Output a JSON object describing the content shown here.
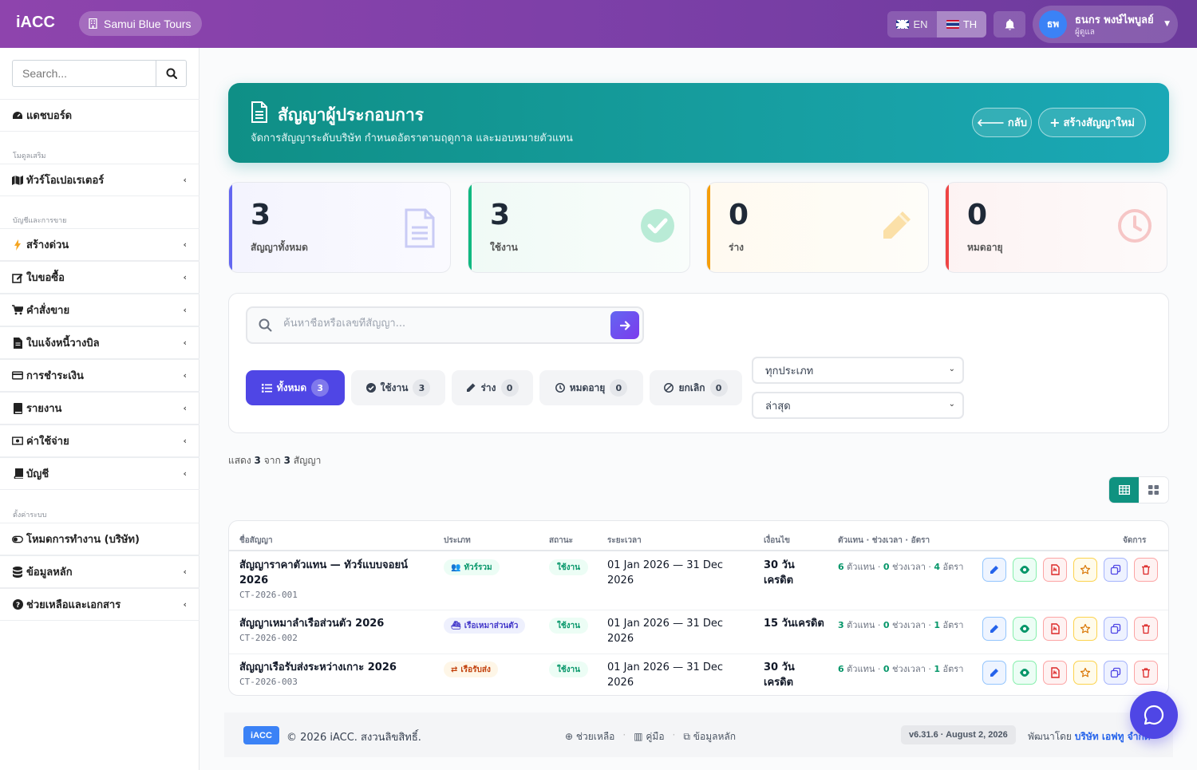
{
  "topbar": {
    "brand": "iACC",
    "company": "Samui Blue Tours",
    "langs": [
      {
        "code": "EN",
        "active": false
      },
      {
        "code": "TH",
        "active": true
      }
    ],
    "user_name": "ธนกร พงษ์ไพบูลย์",
    "user_role": "ผู้ดูแล",
    "user_initials": "ธพ",
    "accent": "#8e44ad"
  },
  "sidebar": {
    "search_placeholder": "Search...",
    "dashboard": "แดชบอร์ด",
    "section_addons": "โมดูลเสริม",
    "tour_operator": "ทัวร์โอเปอเรเตอร์",
    "section_accounting": "บัญชีและการขาย",
    "items": [
      "สร้างด่วน",
      "ใบขอซื้อ",
      "คำสั่งขาย",
      "ใบแจ้งหนี้วางบิล",
      "การชำระเงิน",
      "รายงาน",
      "ค่าใช้จ่าย",
      "บัญชี"
    ],
    "section_settings": "ตั้งค่าระบบ",
    "settings_items": [
      "โหมดการทำงาน (บริษัท)",
      "ข้อมูลหลัก",
      "ช่วยเหลือและเอกสาร"
    ]
  },
  "hero": {
    "title": "สัญญาผู้ประกอบการ",
    "subtitle": "จัดการสัญญาระดับบริษัท กำหนดอัตราตามฤดูกาล และมอบหมายตัวแทน",
    "back_label": "กลับ",
    "new_label": "สร้างสัญญาใหม่",
    "color": "#0f8f86"
  },
  "stats": [
    {
      "value": "3",
      "label": "สัญญาทั้งหมด",
      "color": "#6366f1",
      "icon": "document-icon"
    },
    {
      "value": "3",
      "label": "ใช้งาน",
      "color": "#10b981",
      "icon": "check-circle-icon"
    },
    {
      "value": "0",
      "label": "ร่าง",
      "color": "#f59e0b",
      "icon": "pencil-icon"
    },
    {
      "value": "0",
      "label": "หมดอายุ",
      "color": "#ef4444",
      "icon": "clock-icon"
    }
  ],
  "filters": {
    "search_placeholder": "ค้นหาชื่อหรือเลขที่สัญญา...",
    "tabs": [
      {
        "label": "ทั้งหมด",
        "count": "3",
        "active": true
      },
      {
        "label": "ใช้งาน",
        "count": "3",
        "active": false
      },
      {
        "label": "ร่าง",
        "count": "0",
        "active": false
      },
      {
        "label": "หมดอายุ",
        "count": "0",
        "active": false
      },
      {
        "label": "ยกเลิก",
        "count": "0",
        "active": false
      }
    ],
    "type_select": "ทุกประเภท",
    "sort_select": "ล่าสุด"
  },
  "showing": {
    "prefix": "แสดง",
    "shown": "3",
    "mid": "จาก",
    "total": "3",
    "suffix": "สัญญา"
  },
  "table": {
    "headers": [
      "ชื่อสัญญา",
      "ประเภท",
      "สถานะ",
      "ระยะเวลา",
      "เงื่อนไข",
      "ตัวแทน · ช่วงเวลา · อัตรา",
      "จัดการ"
    ],
    "rows": [
      {
        "name": "สัญญาราคาตัวแทน — ทัวร์แบบจอยน์ 2026",
        "code": "CT-2026-001",
        "type": "ทัวร์รวม",
        "status": "ใช้งาน",
        "period": "01 Jan 2026 — 31 Dec 2026",
        "terms": "30 วัน เครดิต",
        "agents": "6",
        "agents_label": "ตัวแทน",
        "seasons": "0",
        "seasons_label": "ช่วงเวลา",
        "rates": "4",
        "rates_label": "อัตรา"
      },
      {
        "name": "สัญญาเหมาลำเรือส่วนตัว 2026",
        "code": "CT-2026-002",
        "type": "เรือเหมาส่วนตัว",
        "status": "ใช้งาน",
        "period": "01 Jan 2026 — 31 Dec 2026",
        "terms": "15 วันเครดิต",
        "agents": "3",
        "agents_label": "ตัวแทน",
        "seasons": "0",
        "seasons_label": "ช่วงเวลา",
        "rates": "1",
        "rates_label": "อัตรา"
      },
      {
        "name": "สัญญาเรือรับส่งระหว่างเกาะ 2026",
        "code": "CT-2026-003",
        "type": "เรือรับส่ง",
        "status": "ใช้งาน",
        "period": "01 Jan 2026 — 31 Dec 2026",
        "terms": "30 วัน เครดิต",
        "agents": "6",
        "agents_label": "ตัวแทน",
        "seasons": "0",
        "seasons_label": "ช่วงเวลา",
        "rates": "1",
        "rates_label": "อัตรา"
      }
    ]
  },
  "footer": {
    "logo": "iACC",
    "copyright": "© 2026 iACC. สงวนลิขสิทธิ์.",
    "links": [
      "ช่วยเหลือ",
      "คู่มือ",
      "ข้อมูลหลัก"
    ],
    "version": "v6.31.6 · August 2, 2026",
    "dev_prefix": "พัฒนาโดย",
    "dev_name": "บริษัท เอฟทู จำกัด"
  }
}
